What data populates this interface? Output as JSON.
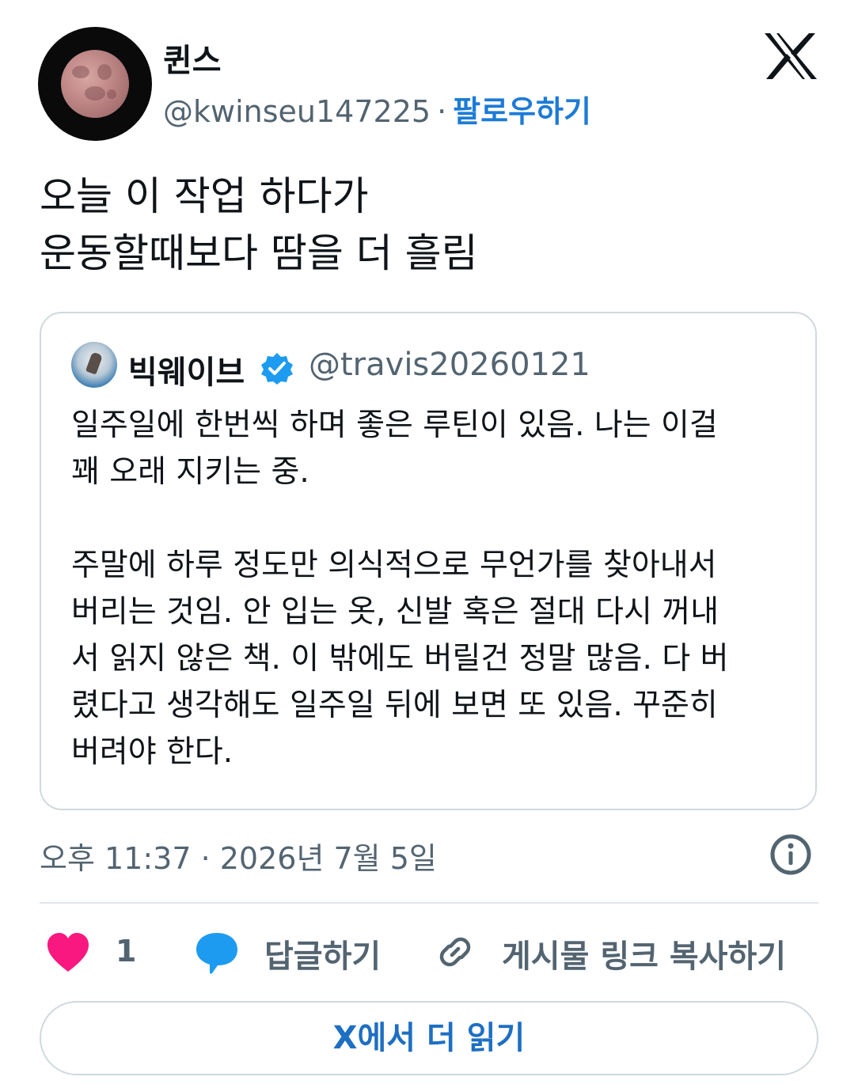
{
  "author": {
    "name": "퀸스",
    "handle": "@kwinseu147225",
    "separator": "·",
    "follow_label": "팔로우하기"
  },
  "tweet": {
    "lines": [
      "오늘 이 작업 하다가",
      "운동할때보다 땀을 더 흘림"
    ]
  },
  "quoted": {
    "name": "빅웨이브",
    "verified": true,
    "handle": "@travis20260121",
    "body": "일주일에 한번씩 하며 좋은 루틴이 있음. 나는 이걸\n꽤 오래 지키는 중.\n\n주말에 하루 정도만 의식적으로 무언가를 찾아내서\n버리는 것임. 안 입는 옷, 신발 혹은 절대 다시 꺼내\n서 읽지 않은 책. 이 밖에도 버릴건 정말 많음. 다 버\n렸다고 생각해도 일주일 뒤에 보면 또 있음. 꾸준히\n버려야 한다."
  },
  "timestamp": "오후 11:37 · 2026년 7월 5일",
  "actions": {
    "like_count": "1",
    "reply_label": "답글하기",
    "copy_link_label": "게시물 링크 복사하기"
  },
  "read_more_label": "X에서 더 읽기",
  "icons": {
    "brand": "x-logo-icon",
    "info": "info-icon",
    "like": "heart-icon",
    "reply": "speech-bubble-icon",
    "link": "link-icon",
    "verified": "verified-badge-icon"
  },
  "colors": {
    "text": "#0f1419",
    "secondary": "#536471",
    "link": "#1d7bd6",
    "heart": "#f91880",
    "reply": "#1d9bf0",
    "border": "#cfd9de"
  }
}
